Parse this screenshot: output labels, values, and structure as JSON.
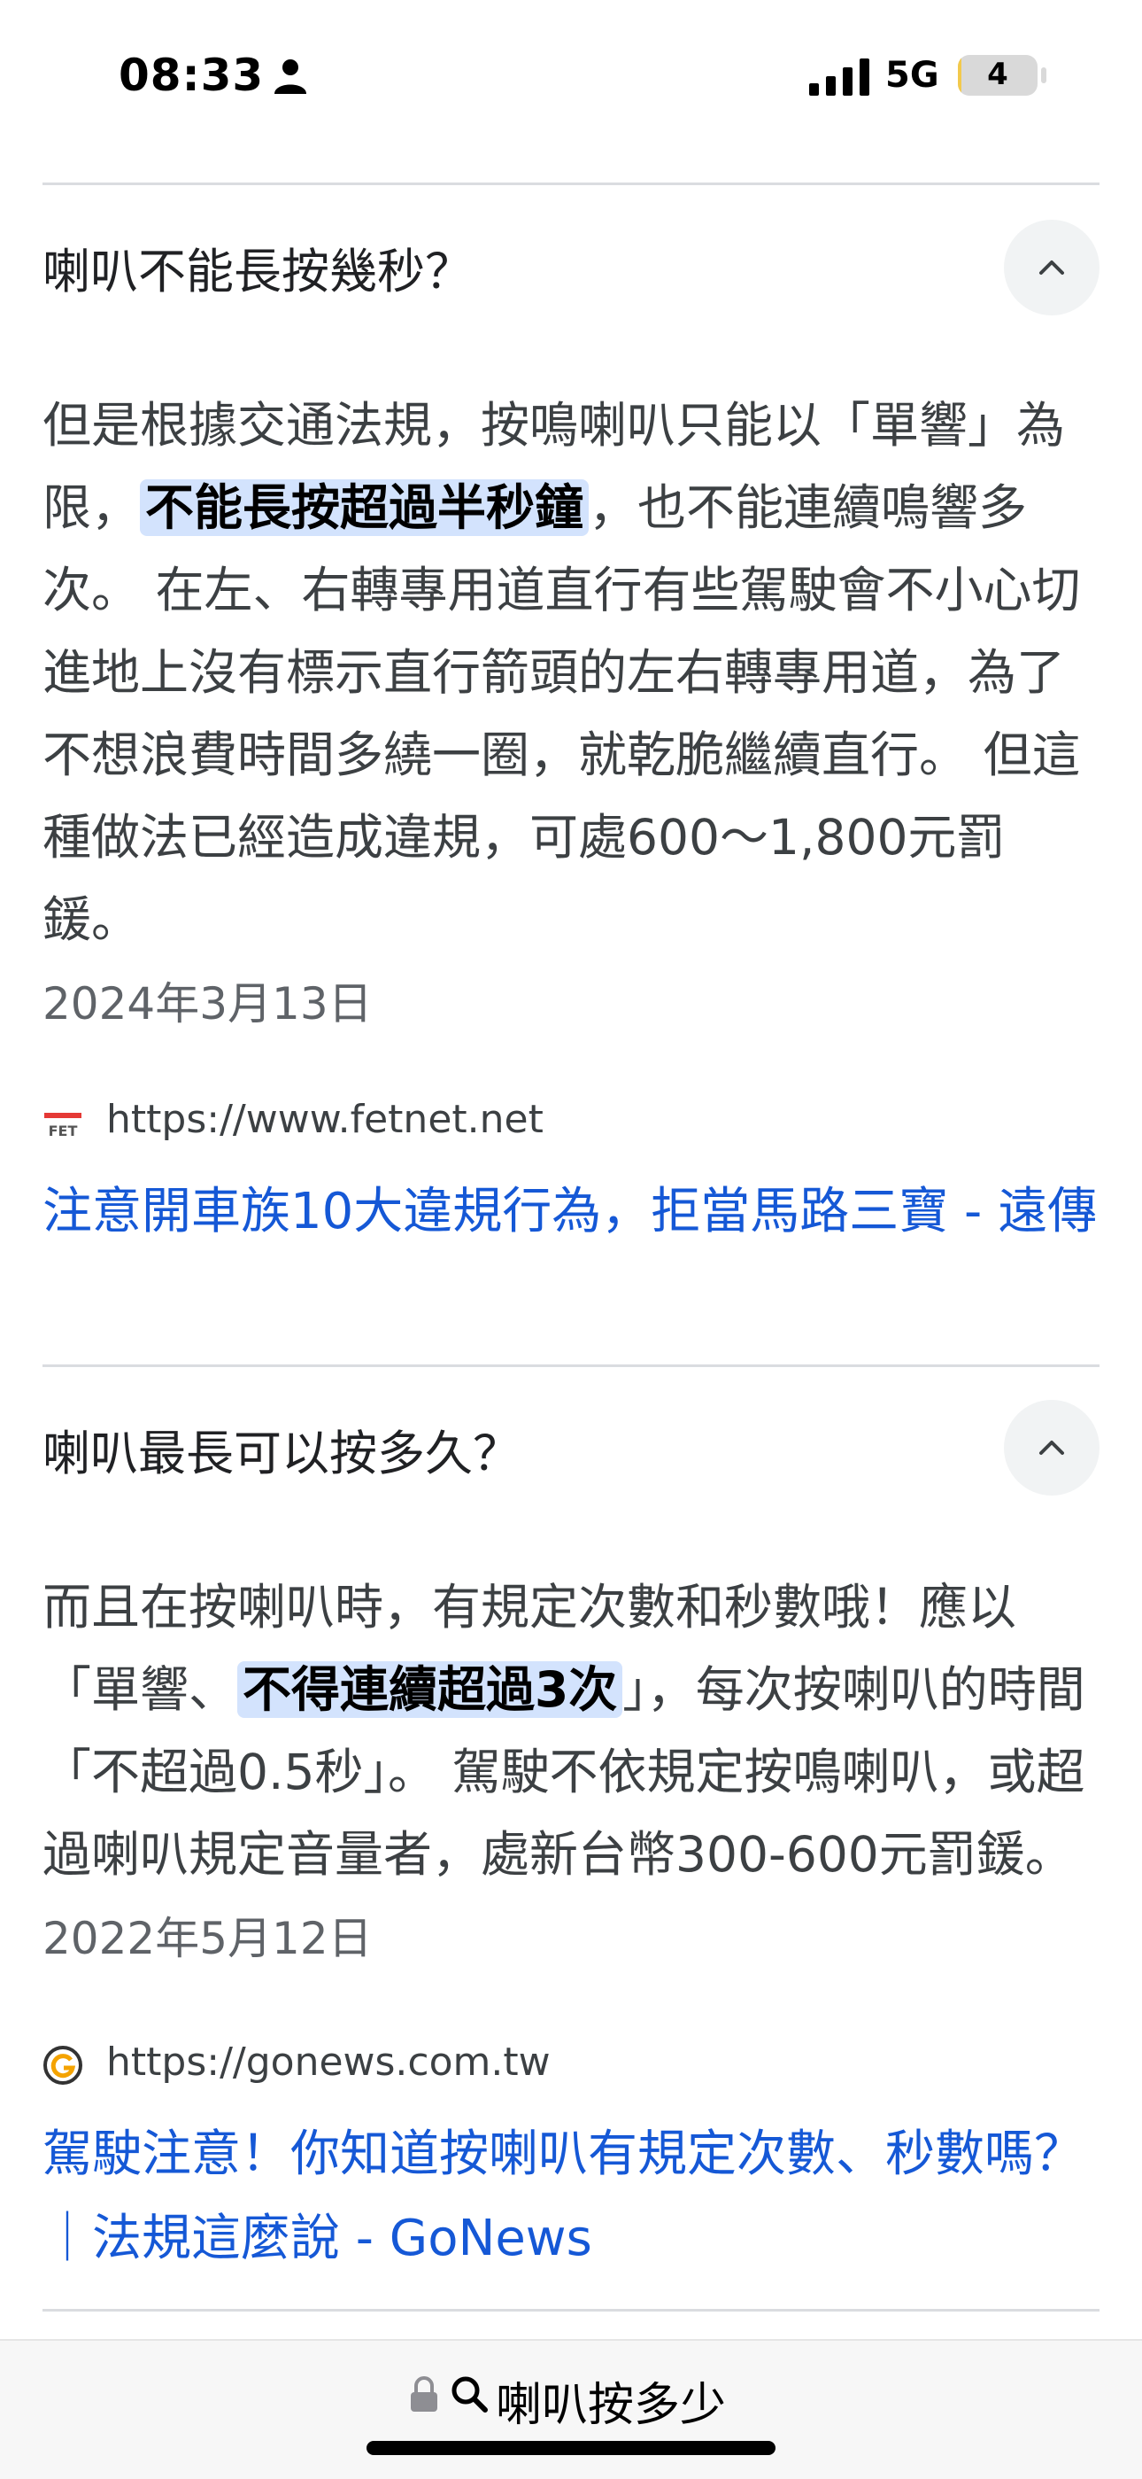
{
  "status_bar": {
    "time": "08:33",
    "network": "5G",
    "battery": "4",
    "battery_level": 0.04
  },
  "faq": [
    {
      "question": "喇叭不能長按幾秒？",
      "answer_parts": [
        "但是根據交通法規，按鳴喇叭只能以「單響」為限，",
        "不能長按超過半秒鐘",
        "，也不能連續鳴響多次。 在左、右轉專用道直行有些駕駛會不小心切進地上沒有標示直行箭頭的左右轉專用道，為了不想浪費時間多繞一圈，就乾脆繼續直行。 但這種做法已經造成違規，可處600～1,800元罰鍰。"
      ],
      "date": "2024年3月13日",
      "source_url": "https://www.fetnet.net",
      "link_title": "注意開車族10大違規行為，拒當馬路三寶 - 遠傳"
    },
    {
      "question": "喇叭最長可以按多久？",
      "answer_parts": [
        "而且在按喇叭時，有規定次數和秒數哦！應以「單響、",
        "不得連續超過3次",
        "」，每次按喇叭的時間「不超過0.5秒」。 駕駛不依規定按鳴喇叭，或超過喇叭規定音量者，處新台幣300-600元罰鍰。"
      ],
      "date": "2022年5月12日",
      "source_url": "https://gonews.com.tw",
      "link_title": "駕駛注意！你知道按喇叭有規定次數、秒數嗎？｜法規這麼說 - GoNews"
    }
  ],
  "url_bar": {
    "query": "喇叭按多少"
  },
  "icons": {
    "expand": "chevron-up-icon",
    "lock": "lock-icon",
    "search": "search-icon",
    "fetnet_favicon": "fetnet-favicon",
    "gonews_favicon": "gonews-favicon"
  },
  "colors": {
    "link": "#1558d6",
    "highlight": "#d3e3fd",
    "battery": "#f2c94c"
  }
}
